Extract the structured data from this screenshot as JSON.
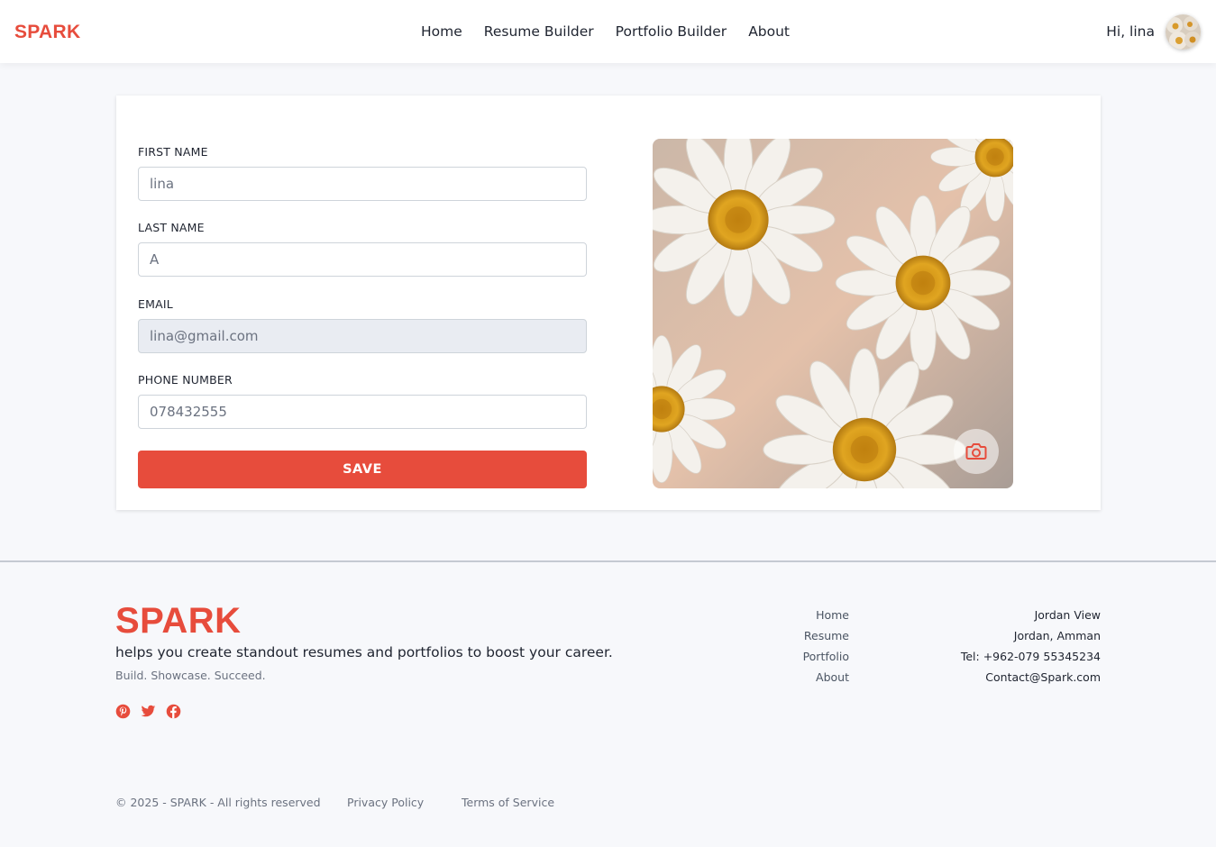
{
  "header": {
    "brand": "SPARK",
    "nav": [
      {
        "label": "Home"
      },
      {
        "label": "Resume Builder"
      },
      {
        "label": "Portfolio Builder"
      },
      {
        "label": "About"
      }
    ],
    "greeting": "Hi, lina"
  },
  "form": {
    "first_name": {
      "label": "FIRST NAME",
      "value": "lina"
    },
    "last_name": {
      "label": "LAST NAME",
      "value": "A"
    },
    "email": {
      "label": "EMAIL",
      "value": "lina@gmail.com"
    },
    "phone": {
      "label": "PHONE NUMBER",
      "value": "078432555"
    },
    "save_label": "SAVE"
  },
  "profile_photo": {
    "camera_icon": "camera-icon"
  },
  "footer": {
    "brand": "SPARK",
    "tagline": "helps you create standout resumes and portfolios to boost your career.",
    "motto": "Build. Showcase. Succeed.",
    "social": [
      "pinterest-icon",
      "twitter-icon",
      "facebook-icon"
    ],
    "links": [
      {
        "label": "Home"
      },
      {
        "label": "Resume"
      },
      {
        "label": "Portfolio"
      },
      {
        "label": "About"
      }
    ],
    "contact": [
      "Jordan View",
      "Jordan, Amman",
      "Tel: +962-079 55345234",
      "Contact@Spark.com"
    ],
    "copyright": "© 2025 - SPARK - All rights reserved",
    "privacy": "Privacy Policy",
    "terms": "Terms of Service"
  },
  "colors": {
    "accent": "#e74c3c",
    "background": "#f7f8fb"
  }
}
